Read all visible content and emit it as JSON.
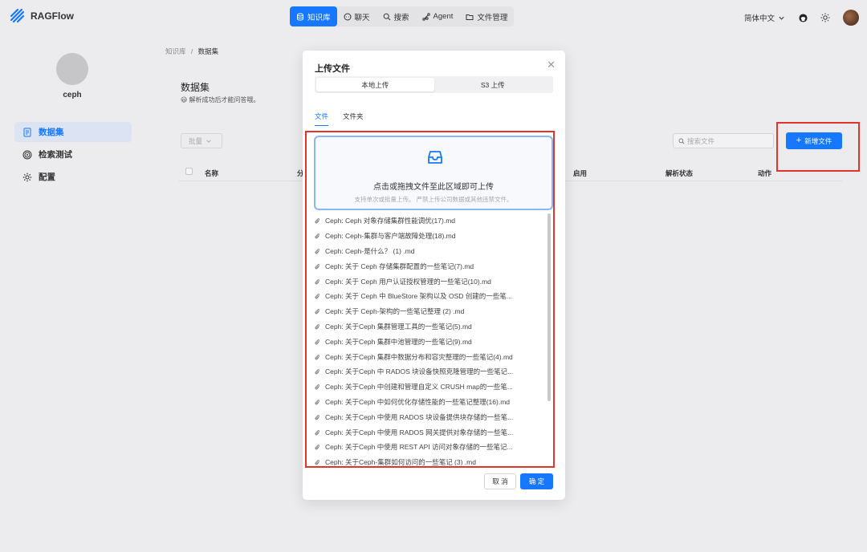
{
  "header": {
    "app_name": "RAGFlow",
    "nav": [
      {
        "label": "知识库",
        "icon": "database-icon",
        "active": true
      },
      {
        "label": "聊天",
        "icon": "chat-icon",
        "active": false
      },
      {
        "label": "搜索",
        "icon": "search-icon",
        "active": false
      },
      {
        "label": "Agent",
        "icon": "agent-icon",
        "active": false
      },
      {
        "label": "文件管理",
        "icon": "folder-icon",
        "active": false
      }
    ],
    "language": "简体中文"
  },
  "sidebar": {
    "kb_name": "ceph",
    "items": [
      {
        "label": "数据集",
        "icon": "document-icon",
        "active": true
      },
      {
        "label": "检索测试",
        "icon": "target-icon",
        "active": false
      },
      {
        "label": "配置",
        "icon": "gear-icon",
        "active": false
      }
    ]
  },
  "main": {
    "breadcrumb": {
      "root": "知识库",
      "separator": "/",
      "current": "数据集"
    },
    "title": "数据集",
    "subtitle": "😃 解析成功后才能问答哦。",
    "batch_label": "批量",
    "search_placeholder": "搜索文件",
    "new_file_label": "新增文件",
    "table_headers": [
      "名称",
      "分",
      "启用",
      "解析状态",
      "动作"
    ]
  },
  "modal": {
    "title": "上传文件",
    "segments": [
      "本地上传",
      "S3 上传"
    ],
    "tabs": [
      "文件",
      "文件夹"
    ],
    "dropzone": {
      "text": "点击或拖拽文件至此区域即可上传",
      "hint": "支持单次或批量上传。 严禁上传公司数据或其他违禁文件。"
    },
    "files": [
      "Ceph:  Ceph 对象存储集群性能调优(17).md",
      "Ceph: Ceph-集群与客户端故障处理(18).md",
      "Ceph: Ceph-是什么？ (1) .md",
      "Ceph: 关于 Ceph 存储集群配置的一些笔记(7).md",
      "Ceph: 关于 Ceph 用户认证授权管理的一些笔记(10).md",
      "Ceph: 关于 Ceph 中 BlueStore 架构以及 OSD 创建的一些笔...",
      "Ceph: 关于 Ceph-架构的一些笔记整理 (2) .md",
      "Ceph: 关于Ceph 集群管理工具的一些笔记(5).md",
      "Ceph: 关于Ceph 集群中池管理的一些笔记(9).md",
      "Ceph: 关于Ceph 集群中数据分布和容灾整理的一些笔记(4).md",
      "Ceph: 关于Ceph 中 RADOS 块设备快照克隆管理的一些笔记...",
      "Ceph: 关于Ceph 中创建和管理自定义 CRUSH map的一些笔...",
      "Ceph: 关于Ceph 中如何优化存储性能的一些笔记整理(16).md",
      "Ceph: 关于Ceph 中使用 RADOS 块设备提供块存储的一些笔...",
      "Ceph: 关于Ceph 中使用 RADOS 网关提供对象存储的一些笔...",
      "Ceph: 关于Ceph 中使用 REST API 访问对象存储的一些笔记...",
      "Ceph: 关于Ceph-集群如何访问的一些笔记 (3) .md"
    ],
    "cancel_label": "取 消",
    "ok_label": "确 定"
  },
  "colors": {
    "accent": "#1677ff",
    "highlight_frame": "#e0342c"
  }
}
